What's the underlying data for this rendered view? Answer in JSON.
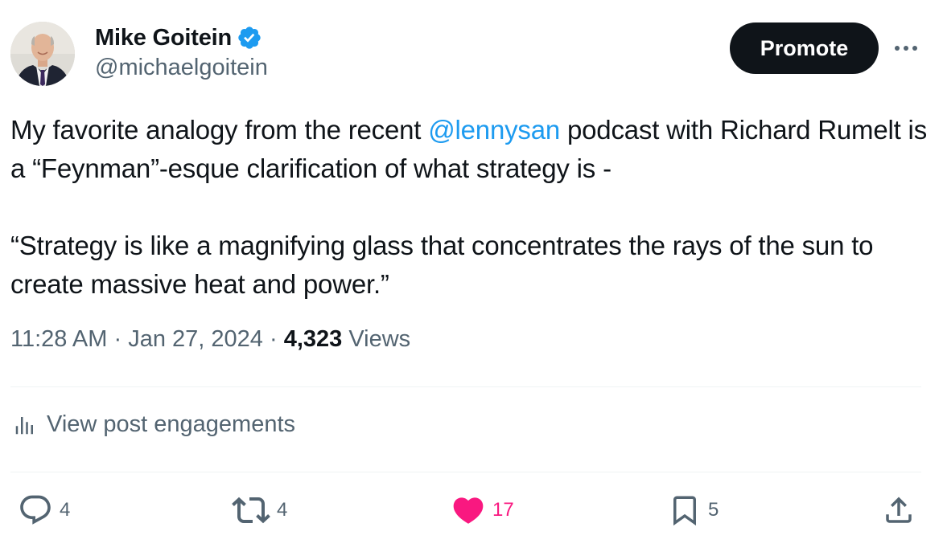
{
  "author": {
    "display_name": "Mike Goitein",
    "handle": "@michaelgoitein",
    "verified": true
  },
  "header": {
    "promote_label": "Promote",
    "more_icon": "more-horizontal-icon"
  },
  "tweet": {
    "line1_before": "My favorite analogy from the recent ",
    "mention": "@lennysan",
    "line1_after": " podcast with Richard Rumelt is a “Feynman”-esque clarification of what strategy is -",
    "quote": "“Strategy is like a magnifying glass that concentrates the rays of the sun to create massive heat and power.”"
  },
  "meta": {
    "time": "11:28 AM",
    "separator": "·",
    "date": "Jan 27, 2024",
    "views_count": "4,323",
    "views_label": "Views"
  },
  "engagements": {
    "label": "View post engagements"
  },
  "actions": {
    "reply_count": "4",
    "repost_count": "4",
    "like_count": "17",
    "bookmark_count": "5"
  },
  "colors": {
    "text": "#0f1419",
    "secondary": "#536471",
    "link": "#1d9bf0",
    "like": "#f91880",
    "verified": "#1d9bf0",
    "promote_bg": "#0f1419"
  }
}
